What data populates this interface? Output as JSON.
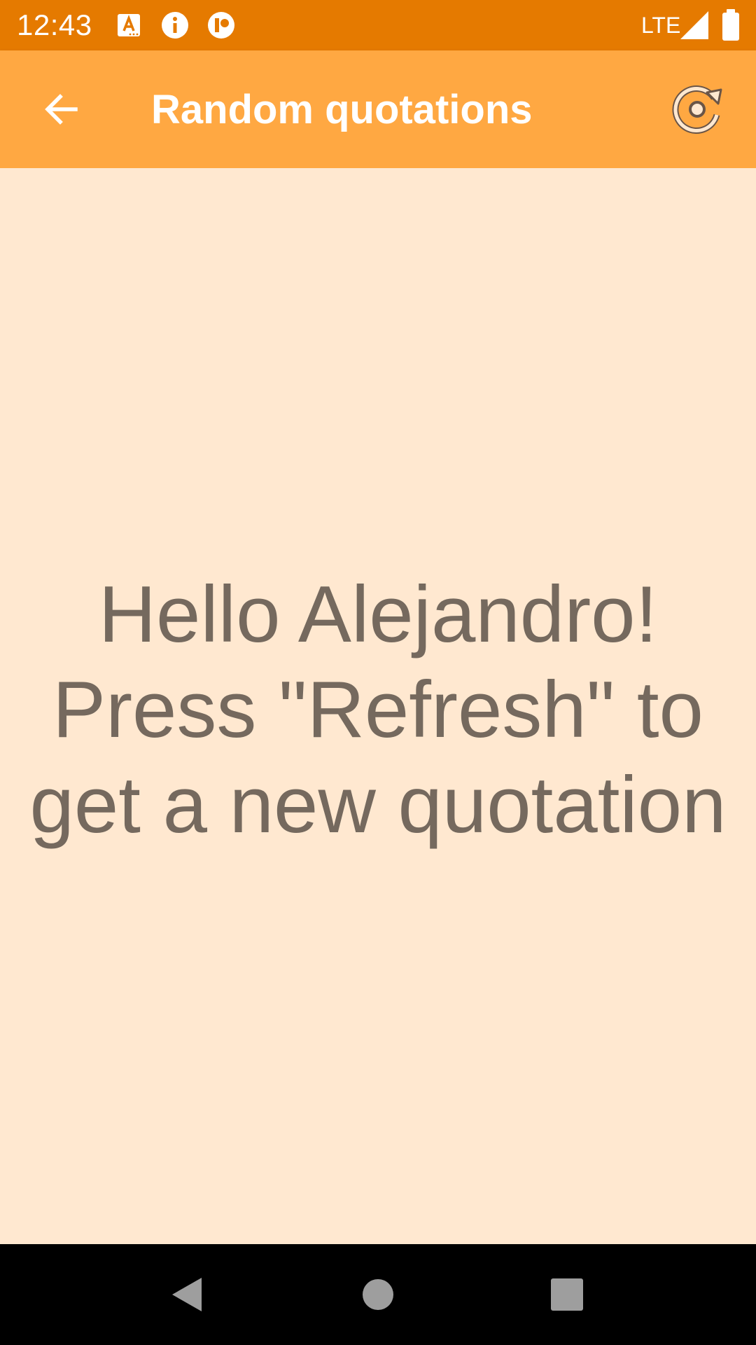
{
  "status_bar": {
    "time": "12:43",
    "network": "LTE",
    "icons": [
      "font-a-icon",
      "info-icon",
      "app-notification-icon",
      "signal-icon",
      "battery-icon"
    ]
  },
  "app_bar": {
    "title": "Random quotations",
    "back_icon": "arrow-back-icon",
    "action_icon": "refresh-icon"
  },
  "main": {
    "message_lines": [
      "Hello Alejandro!",
      "Press \"Refresh\" to",
      "get a new quotation"
    ]
  },
  "nav_bar": {
    "buttons": [
      "back-triangle-icon",
      "home-circle-icon",
      "recents-square-icon"
    ]
  },
  "colors": {
    "status_bar": "#E57A00",
    "app_bar": "#FFA842",
    "background": "#FFE8D0",
    "text": "#75695E",
    "nav_bar": "#000000"
  }
}
